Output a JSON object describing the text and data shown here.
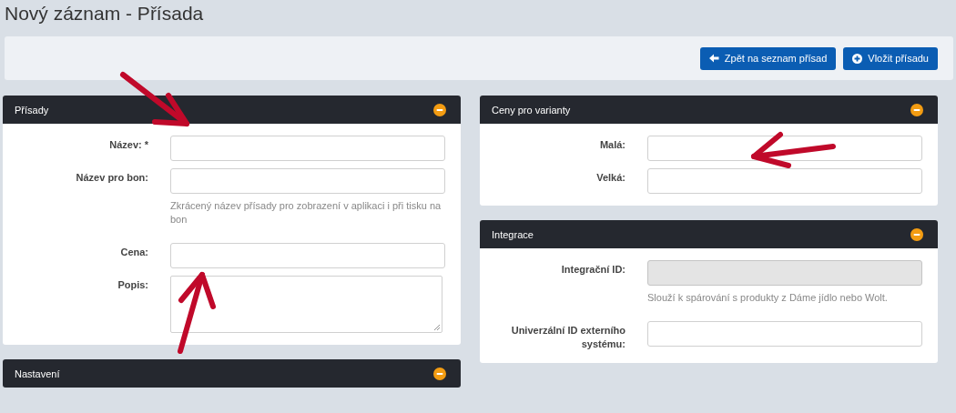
{
  "page_title": "Nový záznam - Přísada",
  "toolbar": {
    "buttons": [
      {
        "label": "Zpět na seznam přísad",
        "kind": "back"
      },
      {
        "label": "Vložit přísadu",
        "kind": "add"
      }
    ]
  },
  "columns": [
    [
      {
        "title": "Přísady",
        "fields": [
          {
            "label": "Název: *",
            "kind": "input",
            "disabled": false
          },
          {
            "label": "Název pro bon:",
            "kind": "input",
            "disabled": false,
            "help": "Zkrácený název přísady pro zobrazení v aplikaci i při tisku na bon"
          },
          {
            "label": "Cena:",
            "kind": "input",
            "disabled": false
          },
          {
            "label": "Popis:",
            "kind": "textarea",
            "disabled": false
          }
        ]
      },
      {
        "title": "Nastavení"
      }
    ],
    [
      {
        "title": "Ceny pro varianty",
        "fields": [
          {
            "label": "Malá:",
            "kind": "input",
            "disabled": false
          },
          {
            "label": "Velká:",
            "kind": "input",
            "disabled": false
          }
        ]
      },
      {
        "title": "Integrace",
        "fields": [
          {
            "label": "Integrační ID:",
            "kind": "input",
            "disabled": true,
            "help": "Slouží k spárování s produkty z Dáme jídlo nebo Wolt."
          },
          {
            "label": "Univerzální ID externího systému:",
            "kind": "input",
            "disabled": false
          }
        ]
      }
    ]
  ]
}
